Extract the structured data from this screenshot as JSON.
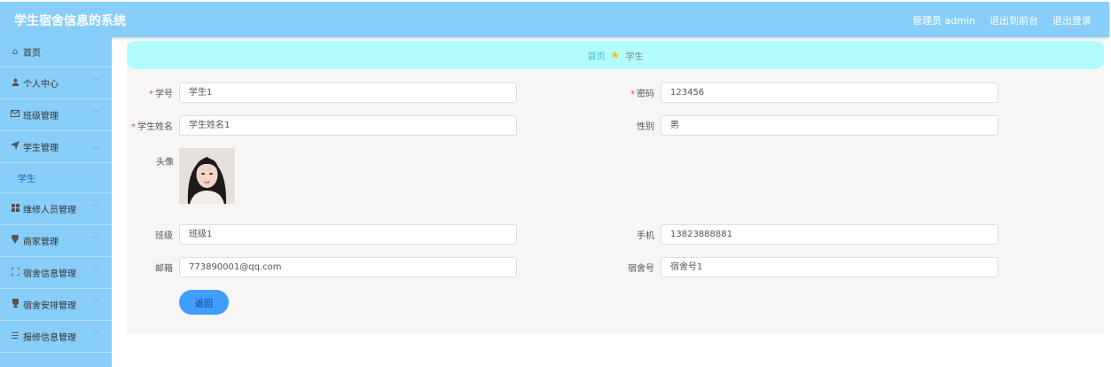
{
  "header": {
    "app_title": "学生宿舍信息的系统",
    "user_label": "管理员 admin",
    "frontend_link": "退出到前台",
    "logout_link": "退出登录"
  },
  "sidebar": {
    "items": [
      {
        "label": "首页",
        "icon": "home-icon"
      },
      {
        "label": "个人中心",
        "icon": "user-icon"
      },
      {
        "label": "班级管理",
        "icon": "mail-icon"
      },
      {
        "label": "学生管理",
        "icon": "send-icon",
        "expanded": true,
        "sub": "学生"
      },
      {
        "label": "维修人员管理",
        "icon": "grid-icon"
      },
      {
        "label": "商家管理",
        "icon": "location-icon"
      },
      {
        "label": "宿舍信息管理",
        "icon": "fullscreen-icon"
      },
      {
        "label": "宿舍安排管理",
        "icon": "trophy-icon"
      },
      {
        "label": "报修信息管理",
        "icon": "menu-icon"
      }
    ]
  },
  "breadcrumb": {
    "home": "首页",
    "current": "学生"
  },
  "form": {
    "student_no": {
      "label": "学号",
      "required": "*",
      "value": "学生1"
    },
    "password": {
      "label": "密码",
      "required": "*",
      "value": "123456"
    },
    "student_name": {
      "label": "学生姓名",
      "required": "*",
      "value": "学生姓名1"
    },
    "gender": {
      "label": "性别",
      "value": "男"
    },
    "avatar": {
      "label": "头像"
    },
    "class": {
      "label": "班级",
      "value": "班级1"
    },
    "phone": {
      "label": "手机",
      "value": "13823888881"
    },
    "email": {
      "label": "邮箱",
      "value": "773890001@qq.com"
    },
    "dorm_no": {
      "label": "宿舍号",
      "value": "宿舍号1"
    }
  },
  "back_button": "返回",
  "colors": {
    "header_bg": "#87cefa",
    "breadcrumb_bg": "#b3fcfc",
    "button_bg": "#409eff",
    "required": "#e34f4f"
  }
}
